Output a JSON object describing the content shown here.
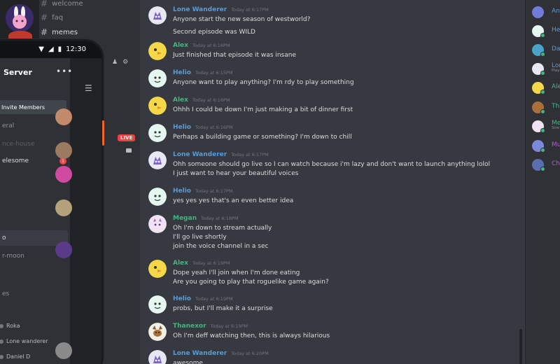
{
  "desktop_channels": [
    {
      "label": "welcome",
      "active": false
    },
    {
      "label": "faq",
      "active": false
    },
    {
      "label": "memes",
      "active": true
    }
  ],
  "phone": {
    "time": "12:30",
    "server_name": "Server",
    "invite_label": "Invite Members",
    "channels": [
      "eral",
      "nce-house",
      "elesome",
      "o",
      "r-moon",
      "es"
    ],
    "badge": "1",
    "users": [
      "Roka",
      "Lone wanderer",
      "Daniel D"
    ],
    "live_label": "LIVE"
  },
  "colors": {
    "accent_blue": "#5b9bd5",
    "alex_green": "#43b581",
    "megan_green": "#43b581",
    "thanexor_green": "#43b581",
    "online": "#43b581",
    "live_red": "#ed4245"
  },
  "messages": [
    {
      "author": "Lone Wanderer",
      "time": "Today at 6:17PM",
      "lines": [
        "Anyone start the new season of westworld?",
        "Second episode was WILD"
      ],
      "color": "#5b9bd5"
    },
    {
      "author": "Alex",
      "time": "Today at 6:16PM",
      "lines": [
        "Just finished that episode it was insane"
      ],
      "color": "#43b581"
    },
    {
      "author": "Helio",
      "time": "Today at 6:15PM",
      "lines": [
        "Anyone want to play anything? I'm rdy to play something"
      ],
      "color": "#5b9bd5"
    },
    {
      "author": "Alex",
      "time": "Today at 6:16PM",
      "lines": [
        "Ohhh I could be down I'm just making a bit of dinner first"
      ],
      "color": "#43b581"
    },
    {
      "author": "Helio",
      "time": "Today at 6:16PM",
      "lines": [
        "Perhaps a building game or something? I'm down to chill"
      ],
      "color": "#5b9bd5"
    },
    {
      "author": "Lone Wanderer",
      "time": "Today at 6:17PM",
      "lines": [
        "Ohh someone should go live so I can watch because i'm lazy and don't want to launch anything lolol",
        "I just want to hear your beautiful voices"
      ],
      "color": "#5b9bd5"
    },
    {
      "author": "Helio",
      "time": "Today at 6:17PM",
      "lines": [
        "yes yes yes that's an even better idea"
      ],
      "color": "#5b9bd5"
    },
    {
      "author": "Megan",
      "time": "Today at 6:18PM",
      "lines": [
        "Oh I'm down to stream actually",
        "I'll go live shortly",
        "join the voice channel in a sec"
      ],
      "color": "#43b581"
    },
    {
      "author": "Alex",
      "time": "Today at 6:19PM",
      "lines": [
        "Dope yeah I'll join when I'm done eating",
        "Are you going to play that roguelike game again?"
      ],
      "color": "#43b581"
    },
    {
      "author": "Helio",
      "time": "Today at 6:19PM",
      "lines": [
        "probs, but I'll make it a surprise"
      ],
      "color": "#5b9bd5"
    },
    {
      "author": "Thanexor",
      "time": "Today at 6:19PM",
      "lines": [
        "Oh I'm deff watching then, this is always hilarious"
      ],
      "color": "#43b581"
    },
    {
      "author": "Lone Wanderer",
      "time": "Today at 6:20PM",
      "lines": [
        "awesome"
      ],
      "color": "#5b9bd5"
    }
  ],
  "members": [
    {
      "name": "An",
      "sub": "",
      "color": "#5b9bd5"
    },
    {
      "name": "He",
      "sub": "",
      "color": "#5b9bd5"
    },
    {
      "name": "Da",
      "sub": "",
      "color": "#5b9bd5"
    },
    {
      "name": "Lon",
      "sub": "Play",
      "color": "#5b9bd5"
    },
    {
      "name": "Ale",
      "sub": "",
      "color": "#43b581"
    },
    {
      "name": "Tha",
      "sub": "",
      "color": "#43b581"
    },
    {
      "name": "Me",
      "sub": "Stre",
      "color": "#43b581"
    },
    {
      "name": "Mu",
      "sub": "",
      "color": "#b05ad6"
    },
    {
      "name": "Ch",
      "sub": "",
      "color": "#b05ad6"
    }
  ]
}
